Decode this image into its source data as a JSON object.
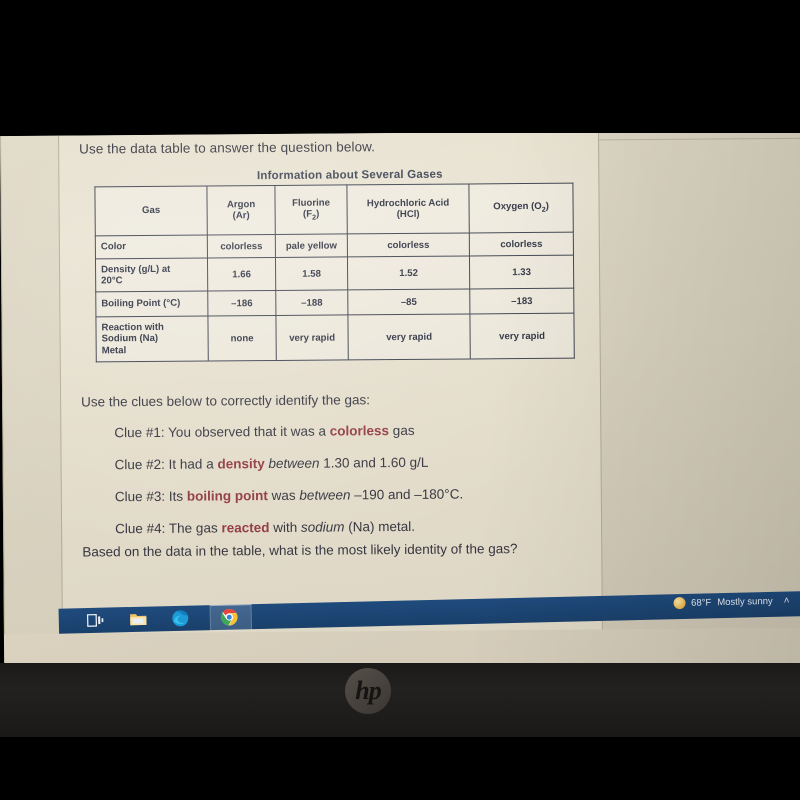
{
  "document": {
    "intro": "Use the data table to answer the question below.",
    "table_title": "Information about Several Gases",
    "final_question": "Based on the data in the table, what is the most likely identity of the gas?",
    "clues_lead": "Use the clues below to correctly identify the gas:"
  },
  "table": {
    "corner_label": "Gas",
    "columns": [
      {
        "name": "Argon",
        "formula": "(Ar)"
      },
      {
        "name": "Fluorine",
        "formula": "(F2)"
      },
      {
        "name": "Hydrochloric Acid",
        "formula": "(HCl)"
      },
      {
        "name": "Oxygen (O2)",
        "formula": ""
      }
    ],
    "rows": [
      {
        "label": "Color",
        "values": [
          "colorless",
          "pale yellow",
          "colorless",
          "colorless"
        ]
      },
      {
        "label": "Density (g/L) at 20°C",
        "values": [
          "1.66",
          "1.58",
          "1.52",
          "1.33"
        ]
      },
      {
        "label": "Boiling Point (°C)",
        "values": [
          "–186",
          "–188",
          "–85",
          "–183"
        ]
      },
      {
        "label": "Reaction with Sodium (Na) Metal",
        "values": [
          "none",
          "very rapid",
          "very rapid",
          "very rapid"
        ]
      }
    ]
  },
  "clues": [
    {
      "prefix": "Clue #1: You observed that it was a ",
      "highlight": "colorless",
      "suffix": " gas",
      "suffix_italic": ""
    },
    {
      "prefix": "Clue #2: It had a ",
      "highlight": "density",
      "italic": "between",
      "suffix": " 1.30 and 1.60 g/L"
    },
    {
      "prefix": "Clue #3: Its ",
      "highlight": "boiling point",
      "mid": " was ",
      "italic": "between",
      "suffix": " –190 and –180°C."
    },
    {
      "prefix": "Clue #4: The gas ",
      "highlight": "reacted",
      "mid": " with ",
      "italic": "sodium",
      "suffix": " (Na) metal."
    }
  ],
  "taskbar": {
    "icons": [
      {
        "name": "task-view",
        "label": "Task View"
      },
      {
        "name": "file-explorer",
        "label": "File Explorer"
      },
      {
        "name": "microsoft-edge",
        "label": "Microsoft Edge"
      },
      {
        "name": "google-chrome",
        "label": "Google Chrome"
      }
    ],
    "weather_temp": "68°F",
    "weather_condition": "Mostly sunny",
    "chevron": "˄"
  },
  "laptop": {
    "brand": "hp"
  },
  "colors": {
    "highlight": "#913a43",
    "taskbar": "#1f4b7d",
    "text": "#35353f",
    "table_border": "#3b3f4c"
  }
}
